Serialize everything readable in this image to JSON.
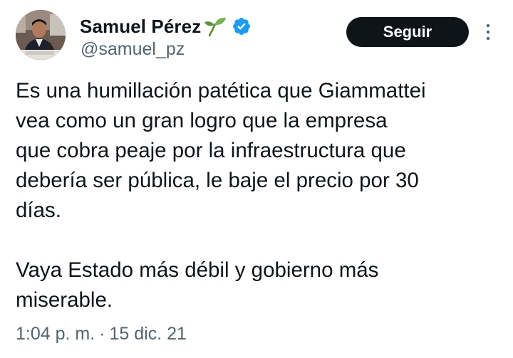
{
  "author": {
    "display_name": "Samuel Pérez",
    "handle": "@samuel_pz",
    "verified": true,
    "badge_emoji_icon": "sprout-icon",
    "verified_color": "#1d9bf0"
  },
  "actions": {
    "follow_label": "Seguir",
    "more_icon": "more-vertical-icon"
  },
  "tweet": {
    "paragraph_1": "Es una humillación patética que Giammattei\nvea como un gran logro que la empresa\nque cobra peaje por la infraestructura que\ndebería ser pública, le baje el precio por 30\ndías.",
    "paragraph_2": "Vaya Estado más débil y gobierno más\nmiserable."
  },
  "meta": {
    "time": "1:04 p. m.",
    "separator": "·",
    "date": "15 dic. 21"
  }
}
